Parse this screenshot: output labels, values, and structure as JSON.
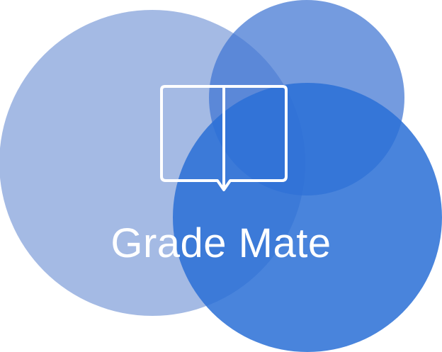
{
  "logo": {
    "app_name": "Grade Mate",
    "icon": "open-book-icon"
  },
  "colors": {
    "background": "#ffffff",
    "circle_left": "#8aa6dc",
    "circle_top_right": "#3f74d2",
    "circle_bottom_right": "#2b70d6",
    "icon_and_text": "#ffffff"
  }
}
